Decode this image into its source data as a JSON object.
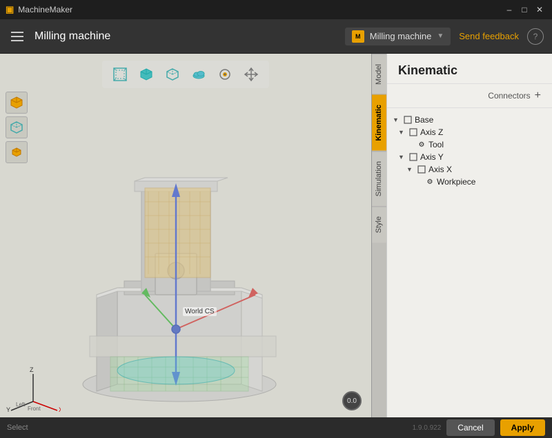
{
  "app": {
    "title": "MachineMaker",
    "window_title": "Milling machine"
  },
  "titlebar": {
    "app_name": "MachineMaker",
    "minimize": "–",
    "maximize": "□",
    "close": "✕"
  },
  "toolbar": {
    "menu_label": "Milling machine",
    "machine_icon": "M",
    "machine_name": "Milling machine",
    "send_feedback": "Send feedback",
    "help": "?"
  },
  "viewport": {
    "tools": [
      {
        "name": "box-view-tool",
        "icon": "⬡",
        "label": "Box view"
      },
      {
        "name": "cube-tool",
        "icon": "◫",
        "label": "Cube"
      },
      {
        "name": "cube-outline-tool",
        "icon": "⬜",
        "label": "Cube outline"
      },
      {
        "name": "cloud-tool",
        "icon": "☁",
        "label": "Cloud"
      },
      {
        "name": "eye-tool",
        "icon": "◎",
        "label": "Eye"
      },
      {
        "name": "cross-tool",
        "icon": "✕",
        "label": "Cross"
      }
    ],
    "left_tools": [
      {
        "name": "cube-yellow",
        "icon": "box"
      },
      {
        "name": "cube-outline",
        "icon": "box-out"
      },
      {
        "name": "cube-small",
        "icon": "box-sm"
      }
    ],
    "world_cs_label": "World CS",
    "camera_value": "0.0"
  },
  "right_tabs": [
    {
      "id": "model",
      "label": "Model",
      "active": false
    },
    {
      "id": "kinematic",
      "label": "Kinematic",
      "active": true
    },
    {
      "id": "simulation",
      "label": "Simulation",
      "active": false
    },
    {
      "id": "style",
      "label": "Style",
      "active": false
    }
  ],
  "right_panel": {
    "title": "Kinematic",
    "connectors_label": "Connectors",
    "add_icon": "+",
    "tree": [
      {
        "id": "base",
        "label": "Base",
        "indent": 0,
        "type": "group",
        "expanded": true
      },
      {
        "id": "axis-z",
        "label": "Axis Z",
        "indent": 1,
        "type": "group",
        "expanded": true
      },
      {
        "id": "tool",
        "label": "Tool",
        "indent": 2,
        "type": "leaf",
        "icon": "⚙"
      },
      {
        "id": "axis-y",
        "label": "Axis Y",
        "indent": 1,
        "type": "group",
        "expanded": true
      },
      {
        "id": "axis-x",
        "label": "Axis X",
        "indent": 2,
        "type": "group",
        "expanded": true
      },
      {
        "id": "workpiece",
        "label": "Workpiece",
        "indent": 3,
        "type": "leaf",
        "icon": "⚙"
      }
    ]
  },
  "statusbar": {
    "select_label": "Select",
    "cancel_label": "Cancel",
    "apply_label": "Apply",
    "version": "1.9.0.922"
  },
  "colors": {
    "accent": "#e8a000",
    "bg_dark": "#2b2b2b",
    "bg_toolbar": "#333",
    "bg_viewport": "#d8d8d0",
    "bg_panel": "#f0efeb",
    "tab_active": "#e8a000"
  }
}
